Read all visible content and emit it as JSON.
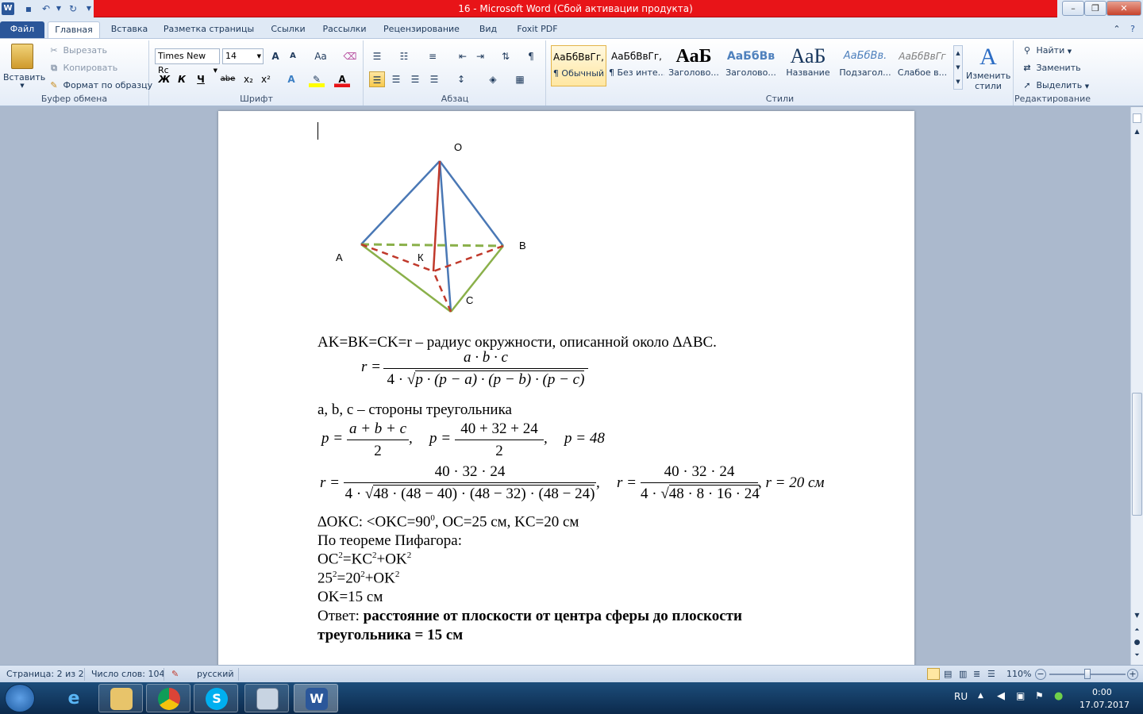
{
  "titlebar": {
    "title": "16 - Microsoft Word (Сбой активации продукта)",
    "qat_icons": [
      "word-app-icon",
      "save-icon",
      "undo-icon",
      "redo-icon",
      "customize-qat-icon"
    ],
    "minimize": "–",
    "restore": "❐",
    "close": "✕"
  },
  "ribbon_tabs": [
    "Файл",
    "Главная",
    "Вставка",
    "Разметка страницы",
    "Ссылки",
    "Рассылки",
    "Рецензирование",
    "Вид",
    "Foxit PDF"
  ],
  "clipboard": {
    "paste": "Вставить",
    "cut": "Вырезать",
    "copy": "Копировать",
    "format_painter": "Формат по образцу",
    "label": "Буфер обмена"
  },
  "font": {
    "name": "Times New Rc",
    "size": "14",
    "grow": "A",
    "shrink": "A",
    "case": "Aa",
    "bold": "Ж",
    "italic": "К",
    "underline": "Ч",
    "strike": "abe",
    "subscript": "x₂",
    "superscript": "x²",
    "label": "Шрифт"
  },
  "paragraph": {
    "label": "Абзац"
  },
  "styles": {
    "items": [
      {
        "preview": "АаБбВвГг,",
        "name": "¶ Обычный"
      },
      {
        "preview": "АаБбВвГг,",
        "name": "¶ Без инте..."
      },
      {
        "preview": "АаБ",
        "name": "Заголово..."
      },
      {
        "preview": "АаБбВв",
        "name": "Заголово..."
      },
      {
        "preview": "АаБ",
        "name": "Название"
      },
      {
        "preview": "АаБбВв.",
        "name": "Подзагол..."
      },
      {
        "preview": "АаБбВвГг",
        "name": "Слабое в..."
      }
    ],
    "change_styles_line1": "Изменить",
    "change_styles_line2": "стили",
    "label": "Стили"
  },
  "editing": {
    "find": "Найти",
    "replace": "Заменить",
    "select": "Выделить",
    "label": "Редактирование"
  },
  "document": {
    "figure_labels": {
      "O": "O",
      "A": "A",
      "B": "B",
      "C": "C",
      "K": "К"
    },
    "line1": "AK=BK=CK=r – радиус окружности, описанной около ∆ABC.",
    "formula_r": {
      "lhs": "r =",
      "num": "a · b · c",
      "den_prefix": "4 ·",
      "den_root": "p · (p − a) · (p − b) · (p − c)"
    },
    "line2": "a, b, c – стороны треугольника",
    "formula_p": {
      "p1_lhs": "p =",
      "p1_num": "a + b + c",
      "p1_den": "2",
      "p1_tail": ",",
      "p2_lhs": "p =",
      "p2_num": "40 + 32 + 24",
      "p2_den": "2",
      "p2_tail": ",",
      "p3": "p = 48"
    },
    "formula_r2": {
      "lhs1": "r =",
      "num1": "40 · 32 · 24",
      "den1_prefix": "4 ·",
      "den1_root": "48 · (48 − 40) · (48 − 32) · (48 − 24)",
      "tail1": ",",
      "lhs2": "r =",
      "num2": "40 · 32 · 24",
      "den2_prefix": "4 ·",
      "den2_root": "48 · 8 · 16 · 24",
      "tail2": ", r = 20 см"
    },
    "okc_line": {
      "before": "∆OKC: <OKC=90",
      "sup": "0",
      "after": ", OC=25 см, KC=20 см"
    },
    "pythagoras": "По теореме Пифагора:",
    "eq1": {
      "a": "OC",
      "a_sup": "2",
      "b": "=KC",
      "b_sup": "2",
      "c": "+OK",
      "c_sup": "2"
    },
    "eq2": {
      "a": "25",
      "a_sup": "2",
      "b": "=20",
      "b_sup": "2",
      "c": "+OK",
      "c_sup": "2"
    },
    "eq3": "OK=15 см",
    "answer_label": "Ответ:",
    "answer_text_1": "расстояние от плоскости от центра сферы до плоскости",
    "answer_text_2": "треугольника = 15 см"
  },
  "statusbar": {
    "page": "Страница: 2 из 2",
    "words": "Число слов: 104",
    "language": "русский",
    "zoom": "110%"
  },
  "taskbar": {
    "apps": [
      "start-orb",
      "internet-explorer",
      "file-explorer",
      "chrome",
      "skype",
      "calculator",
      "word"
    ],
    "lang": "RU",
    "time": "0:00",
    "date": "17.07.2017"
  },
  "colors": {
    "title_red": "#e81418",
    "pyramid_blue": "#4a78b5",
    "pyramid_red": "#c0392b",
    "pyramid_green": "#8ab04a"
  }
}
